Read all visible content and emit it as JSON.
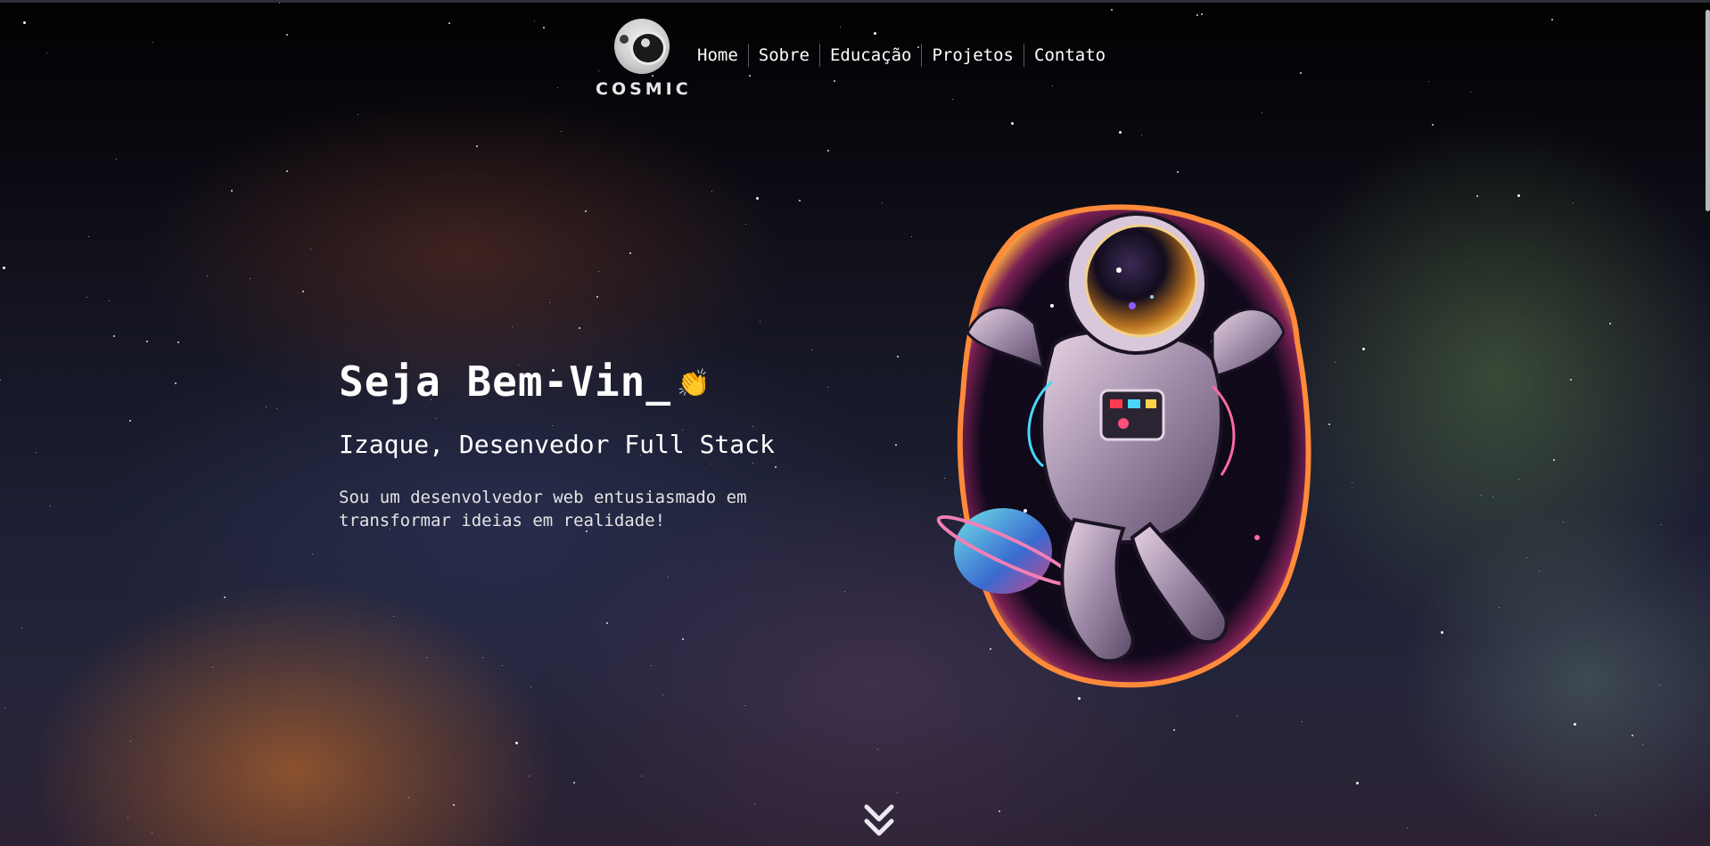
{
  "brand": {
    "logo_text": "COSMIC",
    "icon": "astronaut-helmet-icon"
  },
  "nav": {
    "items": [
      {
        "label": "Home"
      },
      {
        "label": "Sobre"
      },
      {
        "label": "Educação"
      },
      {
        "label": "Projetos"
      },
      {
        "label": "Contato"
      }
    ]
  },
  "hero": {
    "title": "Seja Bem-Vin_",
    "wave_icon": "👏",
    "subtitle": "Izaque, Desenvedor Full Stack",
    "description": "Sou um desenvolvedor web entusiasmado em transformar ideias em realidade!"
  },
  "illustration": {
    "icon": "astronaut-illustration"
  },
  "scroll": {
    "icon": "double-chevron-down-icon"
  },
  "colors": {
    "text": "#ffffff",
    "background": "#05060c",
    "nebula_orange": "#dc7828",
    "nebula_green": "#6e9650"
  }
}
